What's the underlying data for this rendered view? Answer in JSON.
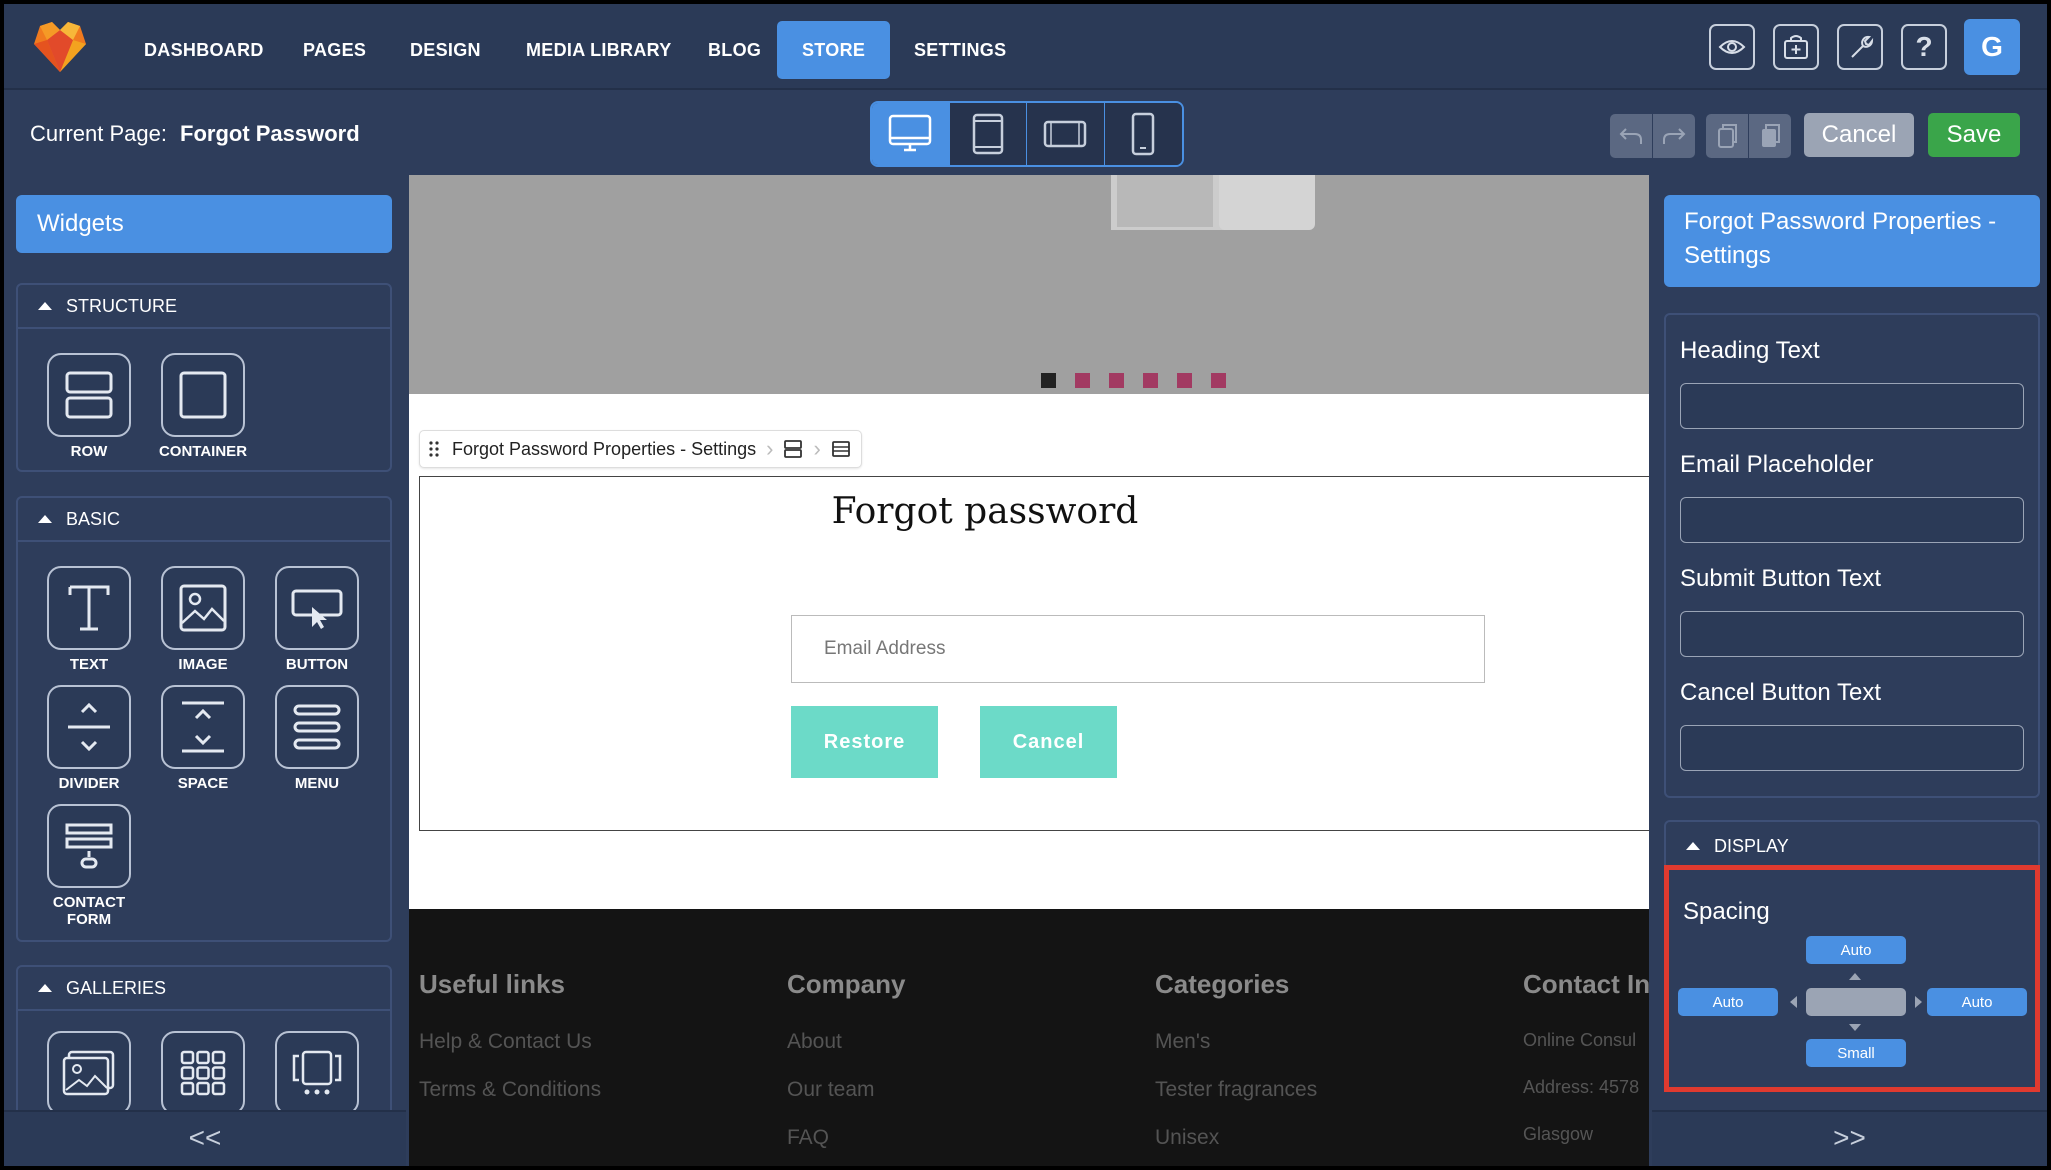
{
  "nav": {
    "items": [
      "DASHBOARD",
      "PAGES",
      "DESIGN",
      "MEDIA LIBRARY",
      "BLOG",
      "STORE",
      "SETTINGS"
    ],
    "active": "STORE",
    "avatar": "G"
  },
  "toolbar": {
    "current_page_label": "Current Page:",
    "current_page_name": "Forgot Password",
    "cancel_label": "Cancel",
    "save_label": "Save"
  },
  "left_panel": {
    "title": "Widgets",
    "sections": [
      {
        "title": "STRUCTURE",
        "widgets": [
          "ROW",
          "CONTAINER"
        ]
      },
      {
        "title": "BASIC",
        "widgets": [
          "TEXT",
          "IMAGE",
          "BUTTON",
          "DIVIDER",
          "SPACE",
          "MENU",
          "CONTACT FORM"
        ]
      },
      {
        "title": "GALLERIES",
        "widgets": []
      }
    ],
    "collapse": "<<"
  },
  "canvas": {
    "breadcrumb": "Forgot Password Properties - Settings",
    "heading": "Forgot password",
    "email_placeholder": "Email Address",
    "restore_label": "Restore",
    "cancel_label": "Cancel",
    "footer": {
      "cols": [
        {
          "title": "Useful links",
          "links": [
            "Help & Contact Us",
            "Terms & Conditions"
          ]
        },
        {
          "title": "Company",
          "links": [
            "About",
            "Our team",
            "FAQ"
          ]
        },
        {
          "title": "Categories",
          "links": [
            "Men's",
            "Tester fragrances",
            "Unisex"
          ]
        },
        {
          "title": "Contact In",
          "links": [
            "Online Consul",
            "Address: 4578",
            "Glasgow"
          ]
        }
      ]
    }
  },
  "right_panel": {
    "title": "Forgot Password Properties - Settings",
    "fields": [
      "Heading Text",
      "Email Placeholder",
      "Submit Button Text",
      "Cancel Button Text"
    ],
    "display_title": "DISPLAY",
    "spacing_label": "Spacing",
    "spacing": {
      "top": "Auto",
      "left": "Auto",
      "right": "Auto",
      "bottom": "Small"
    },
    "expand": ">>"
  },
  "colors": {
    "accent": "#4a90e2",
    "save": "#3aa54a",
    "highlight": "#e03a2f",
    "teal": "#6cdac8"
  }
}
